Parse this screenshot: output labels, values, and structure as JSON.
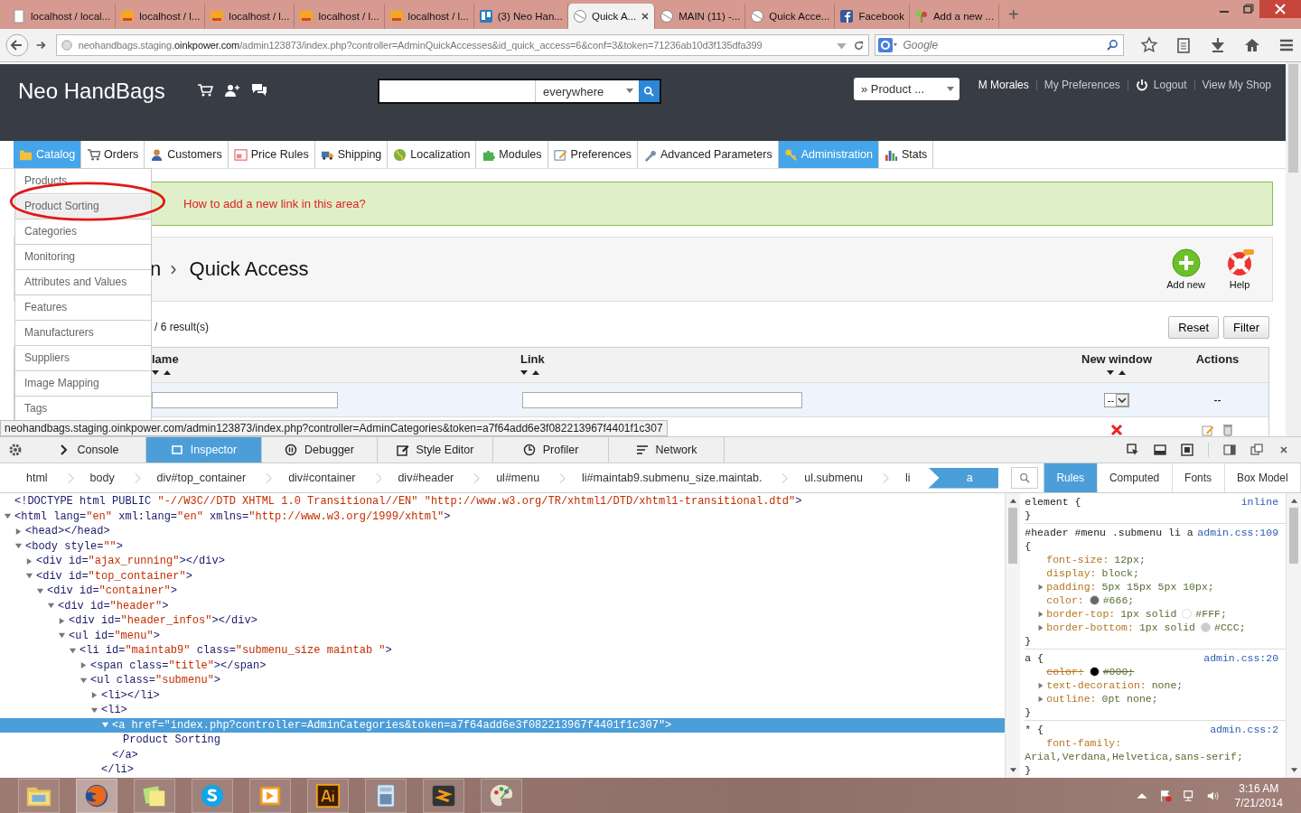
{
  "browser": {
    "tabs": [
      {
        "title": "localhost / local...",
        "selected": false,
        "kind": "page"
      },
      {
        "title": "localhost / l...",
        "selected": false,
        "kind": "pma"
      },
      {
        "title": "localhost / l...",
        "selected": false,
        "kind": "pma"
      },
      {
        "title": "localhost / l...",
        "selected": false,
        "kind": "pma"
      },
      {
        "title": "localhost / l...",
        "selected": false,
        "kind": "pma"
      },
      {
        "title": "(3) Neo Han...",
        "selected": false,
        "kind": "trello"
      },
      {
        "title": "Quick A...",
        "selected": true,
        "kind": "site"
      },
      {
        "title": "MAIN (11) -...",
        "selected": false,
        "kind": "site"
      },
      {
        "title": "Quick Acce...",
        "selected": false,
        "kind": "site"
      },
      {
        "title": "Facebook",
        "selected": false,
        "kind": "facebook"
      },
      {
        "title": "Add a new ...",
        "selected": false,
        "kind": "plant"
      }
    ],
    "new_tab": "+",
    "url": {
      "prefix": "neohandbags.staging.",
      "domain": "oinkpower.com",
      "path": "/admin123873/index.php?controller=AdminQuickAccesses&id_quick_access=6&conf=3&token=71236ab10d3f135dfa399"
    },
    "search": {
      "placeholder": "Google"
    }
  },
  "header": {
    "shop_name": "Neo HandBags",
    "search": {
      "scope": "everywhere"
    },
    "quick_access": "» Product ...",
    "user_links": [
      "M Morales",
      "My Preferences",
      "Logout",
      "View My Shop"
    ]
  },
  "menu": [
    {
      "label": "Catalog",
      "selected": true
    },
    {
      "label": "Orders",
      "selected": false
    },
    {
      "label": "Customers",
      "selected": false
    },
    {
      "label": "Price Rules",
      "selected": false
    },
    {
      "label": "Shipping",
      "selected": false
    },
    {
      "label": "Localization",
      "selected": false
    },
    {
      "label": "Modules",
      "selected": false
    },
    {
      "label": "Preferences",
      "selected": false
    },
    {
      "label": "Advanced Parameters",
      "selected": false
    },
    {
      "label": "Administration",
      "selected": true
    },
    {
      "label": "Stats",
      "selected": false
    }
  ],
  "submenu": [
    {
      "label": "Products",
      "selected": false
    },
    {
      "label": "Product Sorting",
      "selected": true
    },
    {
      "label": "Categories",
      "selected": false
    },
    {
      "label": "Monitoring",
      "selected": false
    },
    {
      "label": "Attributes and Values",
      "selected": false
    },
    {
      "label": "Features",
      "selected": false
    },
    {
      "label": "Manufacturers",
      "selected": false
    },
    {
      "label": "Suppliers",
      "selected": false
    },
    {
      "label": "Image Mapping",
      "selected": false
    },
    {
      "label": "Tags",
      "selected": false
    }
  ],
  "notice": "How to add a new link in this area?",
  "toolbar": {
    "breadcrumb_parent": "n",
    "separator": "›",
    "title": "Quick Access",
    "buttons": [
      "Add new",
      "Help"
    ]
  },
  "list": {
    "result_count": "/ 6 result(s)",
    "buttons": [
      "Reset",
      "Filter"
    ],
    "columns": [
      "lame",
      "Link",
      "New window",
      "Actions"
    ],
    "filter": {
      "new_window": "--",
      "actions": "--"
    },
    "rows": [
      {
        "new_window": false
      }
    ]
  },
  "status_url": "neohandbags.staging.oinkpower.com/admin123873/index.php?controller=AdminCategories&token=a7f64add6e3f082213967f4401f1c307",
  "devtools": {
    "tools": [
      {
        "label": "Console",
        "selected": false
      },
      {
        "label": "Inspector",
        "selected": true
      },
      {
        "label": "Debugger",
        "selected": false
      },
      {
        "label": "Style Editor",
        "selected": false
      },
      {
        "label": "Profiler",
        "selected": false
      },
      {
        "label": "Network",
        "selected": false
      }
    ],
    "breadcrumbs": [
      {
        "label": "html",
        "selected": false
      },
      {
        "label": "body",
        "selected": false
      },
      {
        "label": "div#top_container",
        "selected": false
      },
      {
        "label": "div#container",
        "selected": false
      },
      {
        "label": "div#header",
        "selected": false
      },
      {
        "label": "ul#menu",
        "selected": false
      },
      {
        "label": "li#maintab9.submenu_size.maintab.",
        "selected": false
      },
      {
        "label": "ul.submenu",
        "selected": false
      },
      {
        "label": "li",
        "selected": false
      },
      {
        "label": "a",
        "selected": true
      }
    ],
    "side_tabs": [
      {
        "label": "Rules",
        "selected": true
      },
      {
        "label": "Computed",
        "selected": false
      },
      {
        "label": "Fonts",
        "selected": false
      },
      {
        "label": "Box Model",
        "selected": false
      }
    ],
    "markup": [
      {
        "text": "<!DOCTYPE html PUBLIC \"-//W3C//DTD XHTML 1.0 Transitional//EN\" \"http://www.w3.org/TR/xhtml1/DTD/xhtml1-transitional.dtd\">",
        "selected": false
      },
      {
        "text": "<html lang=\"en\" xml:lang=\"en\" xmlns=\"http://www.w3.org/1999/xhtml\">",
        "expanded": true,
        "selected": false,
        "children": [
          {
            "text": "<head></head>",
            "expanded": false,
            "selected": false
          },
          {
            "text": "<body style=\"\">",
            "expanded": true,
            "selected": false,
            "children": [
              {
                "text": "<div id=\"ajax_running\"></div>",
                "expanded": false,
                "selected": false
              },
              {
                "text": "<div id=\"top_container\">",
                "expanded": true,
                "selected": false,
                "children": [
                  {
                    "text": "<div id=\"container\">",
                    "expanded": true,
                    "selected": false,
                    "children": [
                      {
                        "text": "<div id=\"header\">",
                        "expanded": true,
                        "selected": false,
                        "children": [
                          {
                            "text": "<div id=\"header_infos\"></div>",
                            "expanded": false,
                            "selected": false
                          },
                          {
                            "text": "<ul id=\"menu\">",
                            "expanded": true,
                            "selected": false,
                            "children": [
                              {
                                "text": "<li id=\"maintab9\" class=\"submenu_size maintab \">",
                                "expanded": true,
                                "selected": false,
                                "children": [
                                  {
                                    "text": "<span class=\"title\"></span>",
                                    "expanded": false,
                                    "selected": false
                                  },
                                  {
                                    "text": "<ul class=\"submenu\">",
                                    "expanded": true,
                                    "selected": false,
                                    "children": [
                                      {
                                        "text": "<li></li>",
                                        "expanded": false,
                                        "selected": false
                                      },
                                      {
                                        "text": "<li>",
                                        "expanded": true,
                                        "selected": false,
                                        "children": [
                                          {
                                            "text": "<a href=\"index.php?controller=AdminCategories&token=a7f64add6e3f082213967f4401f1c307\">",
                                            "expanded": true,
                                            "selected": true,
                                            "children": [
                                              {
                                                "text": "Product Sorting",
                                                "selected": false
                                              }
                                            ]
                                          },
                                          {
                                            "text": "</a>",
                                            "selected": false
                                          }
                                        ]
                                      },
                                      {
                                        "text": "</li>",
                                        "selected": false
                                      }
                                    ]
                                  }
                                ]
                              }
                            ]
                          }
                        ]
                      }
                    ]
                  }
                ]
              }
            ]
          }
        ]
      }
    ],
    "rules": [
      {
        "selector": "element {",
        "source": "inline"
      },
      {
        "selector": "#header #menu .submenu li a {",
        "source": "admin.css:109",
        "declarations": [
          {
            "name": "font-size:",
            "value": "12px;",
            "expandable": false,
            "overridden": false
          },
          {
            "name": "display:",
            "value": "block;",
            "expandable": false,
            "overridden": false
          },
          {
            "name": "padding:",
            "value": "5px 15px 5px 10px;",
            "expandable": true,
            "overridden": false
          },
          {
            "name": "color:",
            "value": "#666;",
            "expandable": false,
            "overridden": false,
            "color": "#666666"
          },
          {
            "name": "border-top:",
            "value": "1px solid",
            "swatch_value": "#FFF;",
            "expandable": true,
            "overridden": false,
            "color": "#ffffff"
          },
          {
            "name": "border-bottom:",
            "value": "1px solid",
            "swatch_value": "#CCC;",
            "expandable": true,
            "overridden": false,
            "color": "#cccccc"
          }
        ]
      },
      {
        "selector": "a {",
        "source": "admin.css:20",
        "declarations": [
          {
            "name": "color:",
            "value": "#000;",
            "expandable": false,
            "overridden": true,
            "color": "#000000"
          },
          {
            "name": "text-decoration:",
            "value": "none;",
            "expandable": true,
            "overridden": false
          },
          {
            "name": "outline:",
            "value": "0pt none;",
            "expandable": true,
            "overridden": false
          }
        ]
      },
      {
        "selector": "* {",
        "source": "admin.css:2",
        "declarations": [
          {
            "name": "font-family:",
            "value": "Arial,Verdana,Helvetica,sans-serif;",
            "expandable": false,
            "overridden": false
          }
        ]
      }
    ],
    "closing": "}"
  },
  "taskbar": {
    "apps": [
      {
        "kind": "folder",
        "selected": false
      },
      {
        "kind": "firefox",
        "selected": true
      },
      {
        "kind": "notes",
        "selected": false
      },
      {
        "kind": "skype",
        "selected": false
      },
      {
        "kind": "player",
        "selected": false
      },
      {
        "kind": "illustrator",
        "selected": false
      },
      {
        "kind": "calculator",
        "selected": false
      },
      {
        "kind": "sublime",
        "selected": false
      },
      {
        "kind": "paint",
        "selected": false
      }
    ],
    "time": "3:16 AM",
    "date": "7/21/2014"
  }
}
